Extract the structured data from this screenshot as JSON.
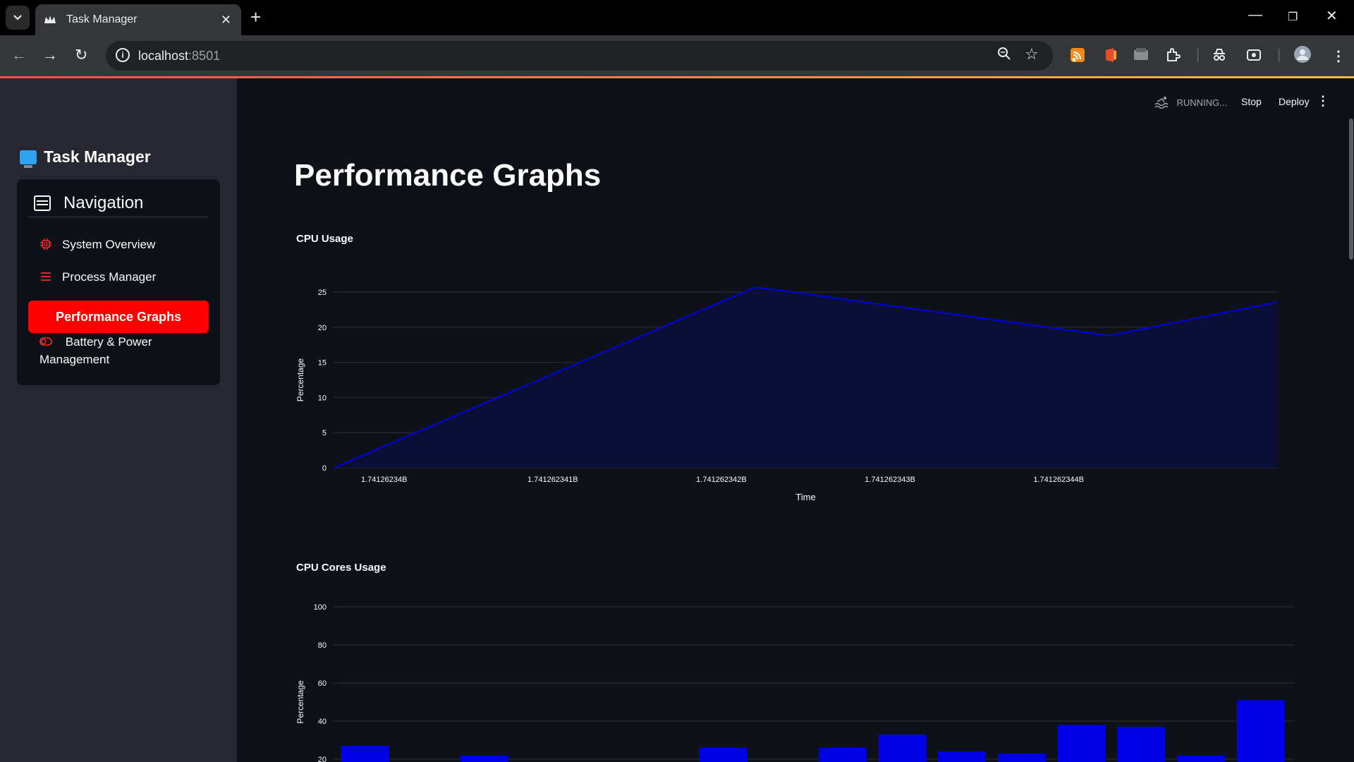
{
  "browser": {
    "tab_title": "Task Manager",
    "url_host": "localhost",
    "url_port": ":8501"
  },
  "app": {
    "status": "RUNNING...",
    "stop_label": "Stop",
    "deploy_label": "Deploy"
  },
  "sidebar": {
    "title": "Task Manager",
    "nav_header": "Navigation",
    "items": [
      {
        "label": "System Overview",
        "icon": "cpu-icon",
        "active": false
      },
      {
        "label": "Process Manager",
        "icon": "list-icon",
        "active": false
      },
      {
        "label": "Performance Graphs",
        "icon": "chart-icon",
        "active": true
      },
      {
        "label": "Battery & Power Management",
        "icon": "toggle-icon",
        "active": false
      }
    ]
  },
  "colors": {
    "accent": "#ff0000",
    "series": "#0000e6",
    "area_fill": "#0c0f38"
  },
  "main": {
    "title": "Performance Graphs"
  },
  "chart_data": [
    {
      "type": "area",
      "title": "CPU Usage",
      "xlabel": "Time",
      "ylabel": "Percentage",
      "x": [
        1741262339.7,
        1741262342.2,
        1741262344.3,
        1741262345.3
      ],
      "y": [
        0,
        25.7,
        18.8,
        23.6
      ],
      "x_ticks": [
        "1.74126234B",
        "1.741262341B",
        "1.741262342B",
        "1.741262343B",
        "1.741262344B"
      ],
      "y_ticks": [
        0,
        5,
        10,
        15,
        20,
        25
      ],
      "ylim": [
        0,
        25
      ],
      "grid": true
    },
    {
      "type": "bar",
      "title": "CPU Cores Usage",
      "ylabel": "Percentage",
      "values": [
        27,
        0,
        22,
        0,
        0,
        0,
        26,
        0,
        26,
        33,
        24,
        23,
        38,
        37,
        22,
        51
      ],
      "y_ticks": [
        20,
        40,
        60,
        80,
        100
      ],
      "ylim": [
        0,
        100
      ],
      "grid": true
    }
  ]
}
